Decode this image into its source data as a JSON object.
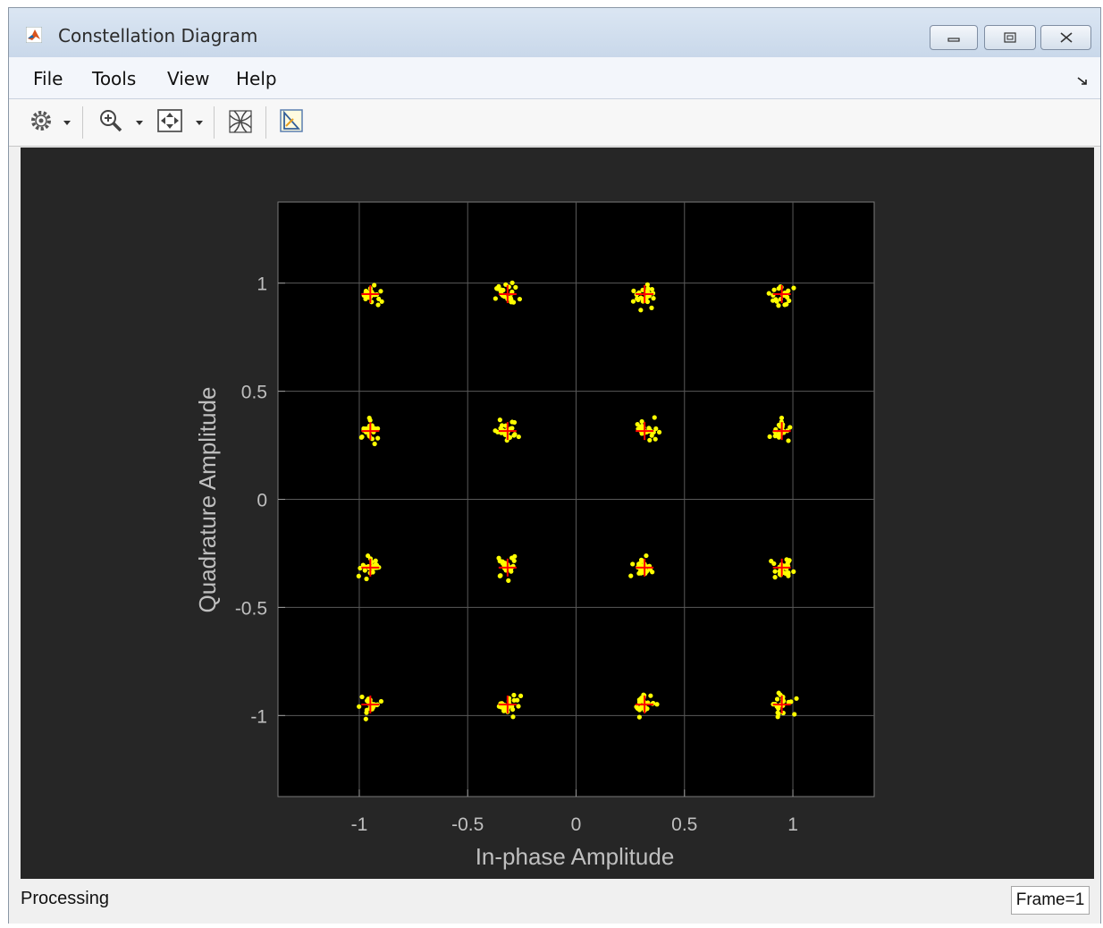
{
  "window": {
    "title": "Constellation Diagram"
  },
  "menu": {
    "items": [
      "File",
      "Tools",
      "View",
      "Help"
    ]
  },
  "toolbar": {
    "icons": [
      "gear-icon",
      "dropdown-arrow-icon",
      "zoom-in-icon",
      "dropdown-arrow-icon",
      "fit-to-view-icon",
      "dropdown-arrow-icon",
      "constellation-reference-icon",
      "measurements-icon"
    ]
  },
  "status": {
    "text": "Processing",
    "frame": "Frame=1"
  },
  "colors": {
    "background": "#262626",
    "axes": "#000000",
    "grid": "#595959",
    "tick_text": "#bfbfbf",
    "points": "#ffff00",
    "reference": "#ff0000"
  },
  "chart_data": {
    "type": "scatter",
    "xlabel": "In-phase Amplitude",
    "ylabel": "Quadrature Amplitude",
    "xlim": [
      -1.375,
      1.375
    ],
    "ylim": [
      -1.375,
      1.375
    ],
    "x_ticks": [
      -1,
      -0.5,
      0,
      0.5,
      1
    ],
    "x_tick_labels": [
      "-1",
      "-0.5",
      "0",
      "0.5",
      "1"
    ],
    "y_ticks": [
      1,
      0.5,
      0,
      -0.5,
      -1
    ],
    "y_tick_labels": [
      "1",
      "0.5",
      "0",
      "-0.5",
      "-1"
    ],
    "grid": true,
    "reference_constellation": {
      "levels": [
        -0.949,
        -0.316,
        0.316,
        0.949
      ],
      "points": [
        [
          -0.949,
          0.949
        ],
        [
          -0.316,
          0.949
        ],
        [
          0.316,
          0.949
        ],
        [
          0.949,
          0.949
        ],
        [
          -0.949,
          0.316
        ],
        [
          -0.316,
          0.316
        ],
        [
          0.316,
          0.316
        ],
        [
          0.949,
          0.316
        ],
        [
          -0.949,
          -0.316
        ],
        [
          -0.316,
          -0.316
        ],
        [
          0.316,
          -0.316
        ],
        [
          0.949,
          -0.316
        ],
        [
          -0.949,
          -0.949
        ],
        [
          -0.316,
          -0.949
        ],
        [
          0.316,
          -0.949
        ],
        [
          0.949,
          -0.949
        ]
      ]
    },
    "received_symbols": {
      "points_per_cluster": 24,
      "spread": 0.035
    }
  }
}
